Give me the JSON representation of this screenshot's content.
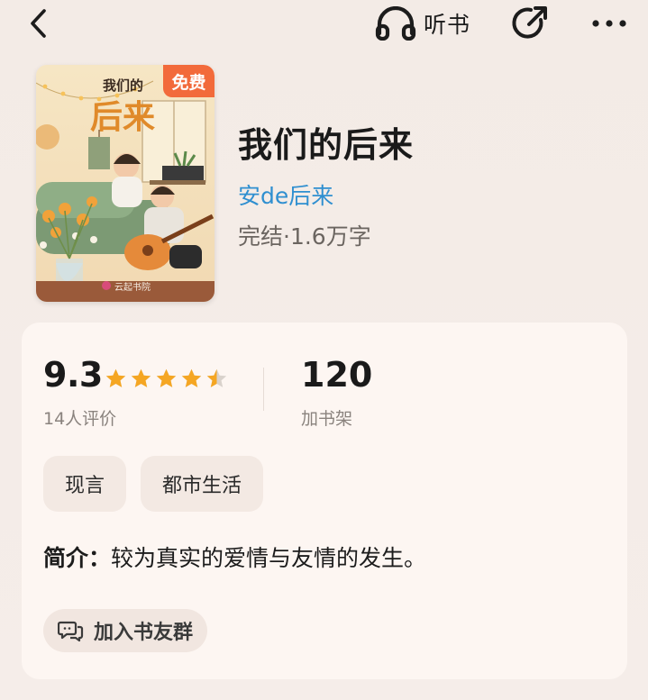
{
  "topbar": {
    "back_icon": "chevron-left-icon",
    "listen_icon": "headphones-icon",
    "listen_label": "听书",
    "share_icon": "share-arrow-icon",
    "more_icon": "more-dots-icon"
  },
  "book": {
    "cover_title_line1": "我们的",
    "cover_title_line2": "后来",
    "cover_publisher": "云起书院",
    "free_badge": "免费",
    "title": "我们的后来",
    "author": "安de后来",
    "status": "完结·1.6万字"
  },
  "rating": {
    "score": "9.3",
    "stars_value": 4.5,
    "stars_max": 5,
    "count_label": "14人评价"
  },
  "shelf": {
    "count": "120",
    "label": "加书架"
  },
  "tags": [
    "现言",
    "都市生活"
  ],
  "intro": {
    "label": "简介：",
    "text": "较为真实的爱情与友情的发生。"
  },
  "group_button": {
    "icon": "chat-bubbles-icon",
    "label": "加入书友群"
  },
  "colors": {
    "background": "#f5ede8",
    "card": "#fdf6f2",
    "author_link": "#2f8fd0",
    "free_badge": "#f26a3b",
    "star": "#f5a623",
    "star_empty": "#d9d2cc"
  }
}
